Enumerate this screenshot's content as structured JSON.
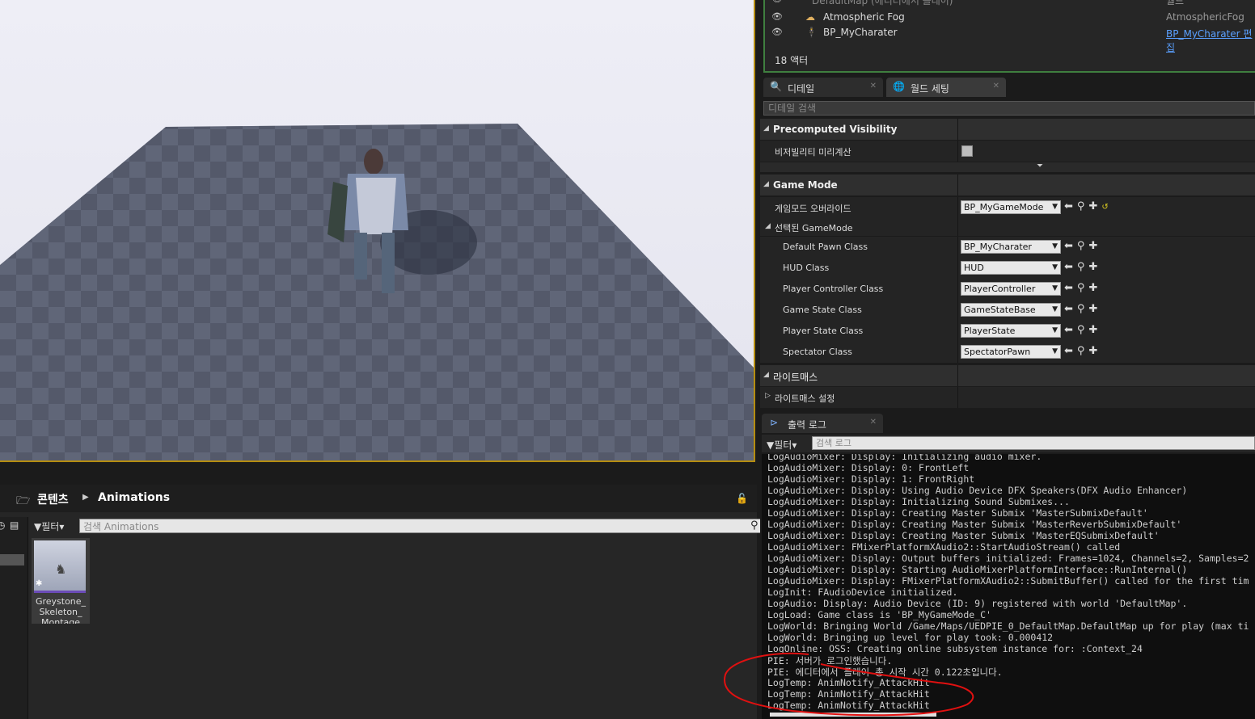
{
  "outliner": {
    "top_row": "DefaultMap (에디터에서 플레이)",
    "top_type": "월드",
    "rows": [
      {
        "name": "Atmospheric Fog",
        "type": "AtmosphericFog",
        "type_link": false
      },
      {
        "name": "BP_MyCharater",
        "type": "BP_MyCharater 편집",
        "type_link": true
      }
    ],
    "count_label": "18 액터"
  },
  "tabs": [
    {
      "label": "디테일",
      "icon": "magnifier-icon"
    },
    {
      "label": "월드 세팅",
      "icon": "globe-icon"
    }
  ],
  "details": {
    "search_placeholder": "디테일 검색",
    "sections": {
      "precomputed": "Precomputed Visibility",
      "gamemode": "Game Mode",
      "selected_gamemode": "선택된 GameMode",
      "lightmass": "라이트매스",
      "lightmass_settings": "라이트매스 설정"
    },
    "precomputed_label": "비저빌리티 미리계산",
    "precomputed_checked": false,
    "gamemode_override_label": "게임모드 오버라이드",
    "gamemode_override_value": "BP_MyGameMode",
    "classes": [
      {
        "label": "Default Pawn Class",
        "value": "BP_MyCharater"
      },
      {
        "label": "HUD Class",
        "value": "HUD"
      },
      {
        "label": "Player Controller Class",
        "value": "PlayerController"
      },
      {
        "label": "Game State Class",
        "value": "GameStateBase"
      },
      {
        "label": "Player State Class",
        "value": "PlayerState"
      },
      {
        "label": "Spectator Class",
        "value": "SpectatorPawn"
      }
    ]
  },
  "output_log": {
    "tab_label": "출력 로그",
    "filter_label": "필터",
    "search_placeholder": "검색 로그",
    "lines": [
      "LogAudioMixer: Display: Initializing audio mixer.",
      "LogAudioMixer: Display: 0: FrontLeft",
      "LogAudioMixer: Display: 1: FrontRight",
      "LogAudioMixer: Display: Using Audio Device DFX Speakers(DFX Audio Enhancer)",
      "LogAudioMixer: Display: Initializing Sound Submixes...",
      "LogAudioMixer: Display: Creating Master Submix 'MasterSubmixDefault'",
      "LogAudioMixer: Display: Creating Master Submix 'MasterReverbSubmixDefault'",
      "LogAudioMixer: Display: Creating Master Submix 'MasterEQSubmixDefault'",
      "LogAudioMixer: FMixerPlatformXAudio2::StartAudioStream() called",
      "LogAudioMixer: Display: Output buffers initialized: Frames=1024, Channels=2, Samples=2",
      "LogAudioMixer: Display: Starting AudioMixerPlatformInterface::RunInternal()",
      "LogAudioMixer: Display: FMixerPlatformXAudio2::SubmitBuffer() called for the first tim",
      "LogInit: FAudioDevice initialized.",
      "LogAudio: Display: Audio Device (ID: 9) registered with world 'DefaultMap'.",
      "LogLoad: Game class is 'BP_MyGameMode_C'",
      "LogWorld: Bringing World /Game/Maps/UEDPIE_0_DefaultMap.DefaultMap up for play (max ti",
      "LogWorld: Bringing up level for play took: 0.000412",
      "LogOnline: OSS: Creating online subsystem instance for: :Context_24",
      "PIE: 서버가 로그인했습니다.",
      "PIE: 에디터에서 플레이 총 시작 시간 0.122초입니다.",
      "LogTemp: AnimNotify_AttackHit",
      "LogTemp: AnimNotify_AttackHit",
      "LogTemp: AnimNotify_AttackHit"
    ]
  },
  "content_browser": {
    "root": "콘텐츠",
    "folder": "Animations",
    "filter_label": "필터",
    "search_placeholder": "검색 Animations",
    "asset": "Greystone_ Skeleton_ Montage"
  },
  "colors": {
    "viewport_border": "#b58d10",
    "annotation": "#e01010",
    "link": "#5aa0ff"
  }
}
